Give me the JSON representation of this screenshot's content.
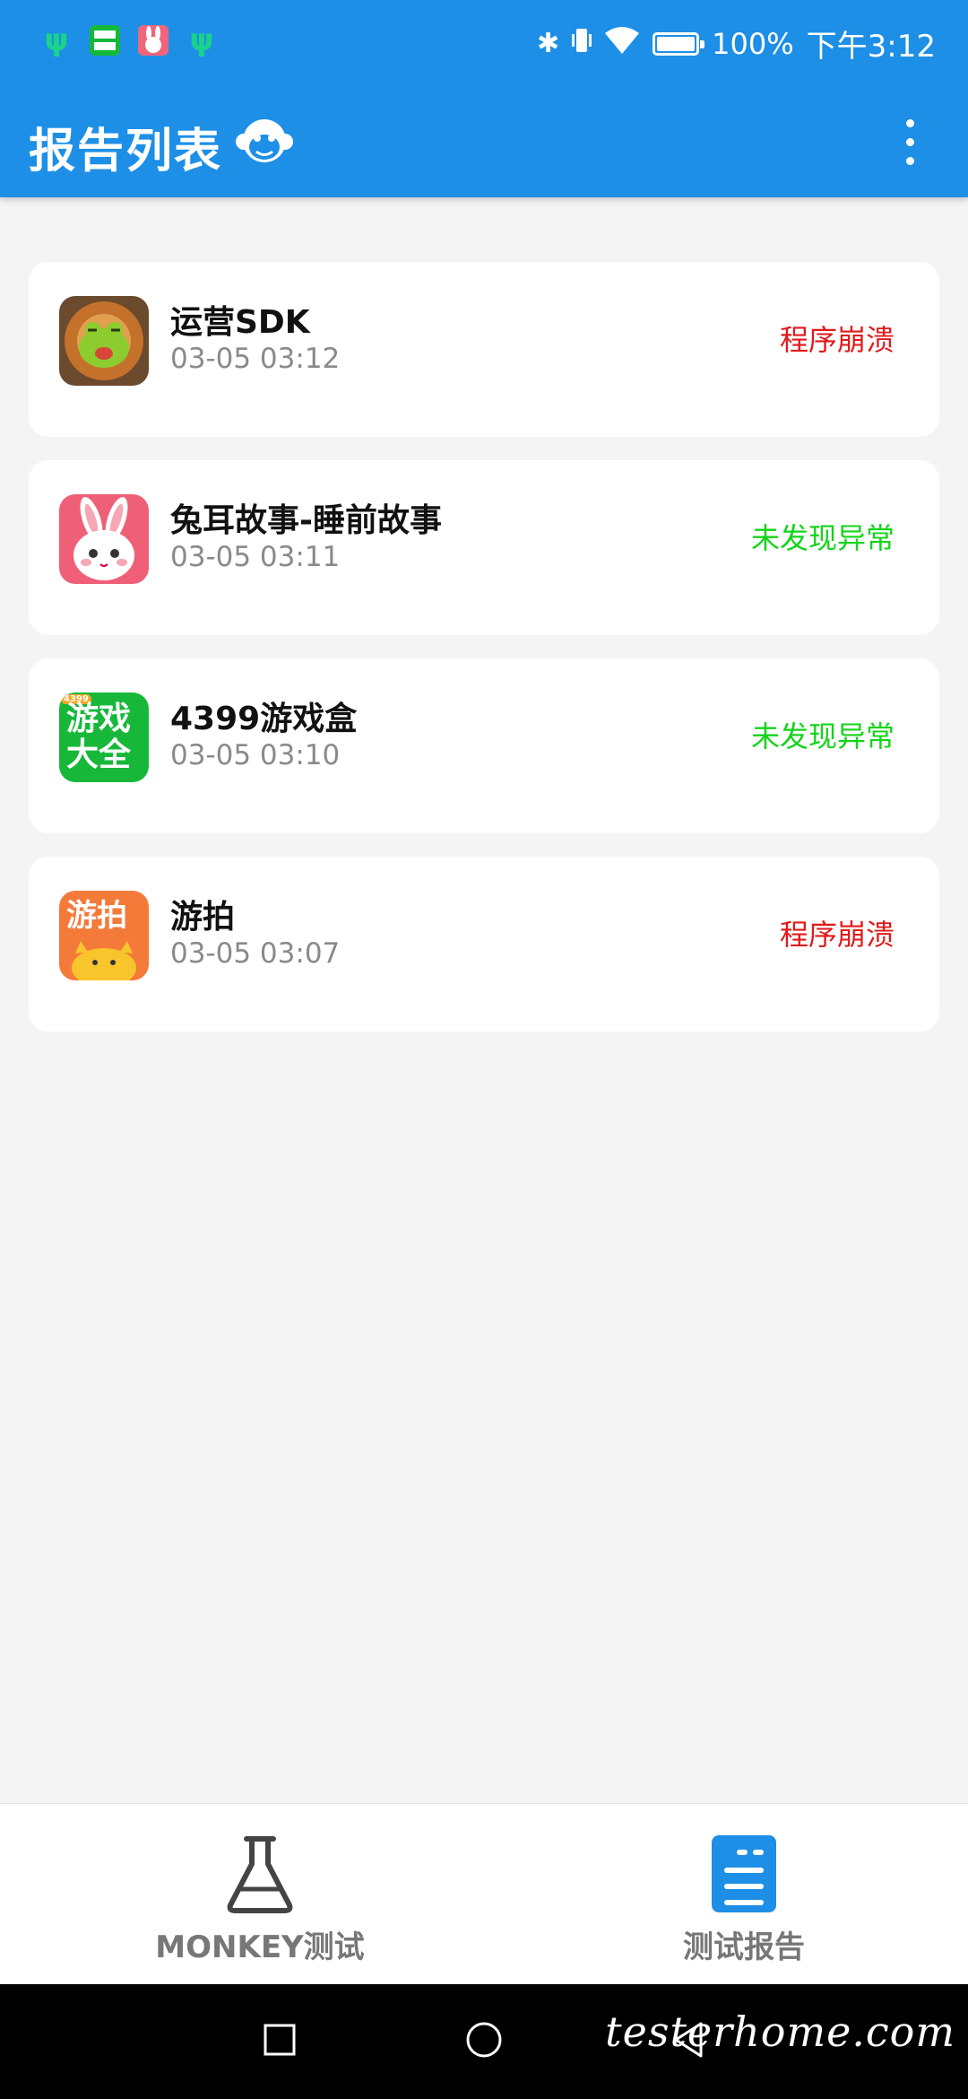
{
  "status_bar": {
    "left_icons": [
      "usb-icon",
      "4399-app-icon",
      "rabbit-app-icon",
      "usb-icon"
    ],
    "battery_percent": 100,
    "battery_text": "100%",
    "time": "下午3:12"
  },
  "app_bar": {
    "title": "报告列表",
    "mascot_icon": "monkey-icon",
    "menu_icon": "more-vert-icon"
  },
  "reports": [
    {
      "name": "运营SDK",
      "time": "03-05 03:12",
      "status": "程序崩溃",
      "status_type": "crash",
      "icon": "frog-app-icon"
    },
    {
      "name": "兔耳故事-睡前故事",
      "time": "03-05 03:11",
      "status": "未发现异常",
      "status_type": "ok",
      "icon": "rabbit-app-icon"
    },
    {
      "name": "4399游戏盒",
      "time": "03-05 03:10",
      "status": "未发现异常",
      "status_type": "ok",
      "icon": "game-box-app-icon"
    },
    {
      "name": "游拍",
      "time": "03-05 03:07",
      "status": "程序崩溃",
      "status_type": "crash",
      "icon": "youpai-app-icon"
    }
  ],
  "app_icons": {
    "game_box_line1": "游戏",
    "game_box_line2": "大全",
    "game_box_badge": "4399",
    "youpai": "游拍"
  },
  "bottom_nav": {
    "tabs": [
      {
        "label": "MONKEY测试",
        "icon": "flask-icon",
        "active": false
      },
      {
        "label": "测试报告",
        "icon": "report-icon",
        "active": true
      }
    ]
  },
  "system_nav": {
    "watermark": "testerhome.com",
    "buttons": [
      "recents-icon",
      "home-icon",
      "back-icon"
    ]
  },
  "colors": {
    "primary": "#1e8fe6",
    "crash": "#e11a1a",
    "ok": "#14d41a"
  }
}
